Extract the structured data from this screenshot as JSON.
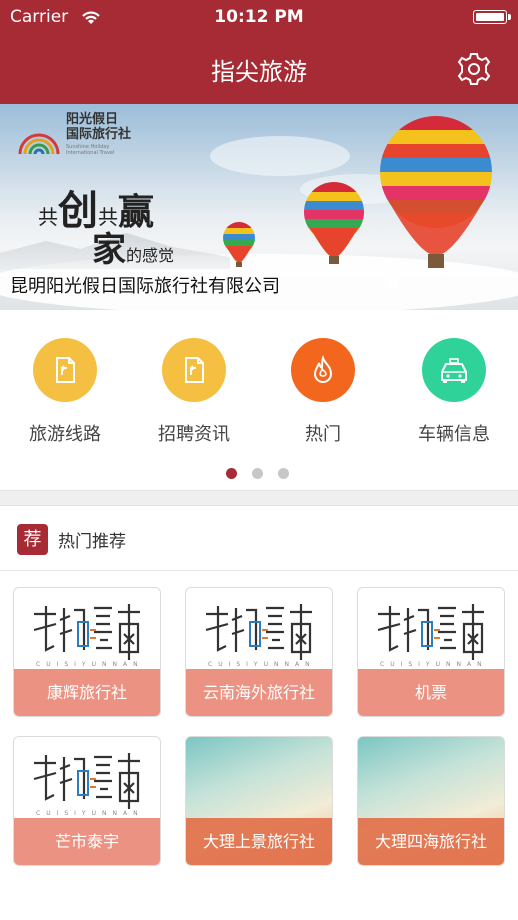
{
  "status_bar": {
    "carrier": "Carrier",
    "time": "10:12 PM"
  },
  "nav": {
    "title": "指尖旅游",
    "settings_icon": "gear-icon"
  },
  "banner": {
    "logo_line1": "阳光假日",
    "logo_line2": "国际旅行社",
    "logo_sub1": "Sunshine Holiday",
    "logo_sub2": "International Travel",
    "slogan_part1": "共",
    "slogan_part2": "创",
    "slogan_part3": "共",
    "slogan_part4": "赢",
    "slogan_part5": "家",
    "slogan_part6": "的感觉",
    "caption": "昆明阳光假日国际旅行社有限公司"
  },
  "quick_menu": [
    {
      "label": "旅游线路",
      "icon": "document-icon",
      "color": "#f5c042"
    },
    {
      "label": "招聘资讯",
      "icon": "document-icon",
      "color": "#f5c042"
    },
    {
      "label": "热门",
      "icon": "flame-icon",
      "color": "#f2661e"
    },
    {
      "label": "车辆信息",
      "icon": "car-icon",
      "color": "#2fd39a"
    }
  ],
  "section": {
    "tag": "荐",
    "title": "热门推荐"
  },
  "cards": [
    {
      "label": "康辉旅行社"
    },
    {
      "label": "云南海外旅行社"
    },
    {
      "label": "机票"
    },
    {
      "label": "芒市泰宇"
    },
    {
      "label": "大理上景旅行社"
    },
    {
      "label": "大理四海旅行社"
    }
  ],
  "colors": {
    "brand": "#a72b34",
    "card_caption": "#e87a68"
  }
}
